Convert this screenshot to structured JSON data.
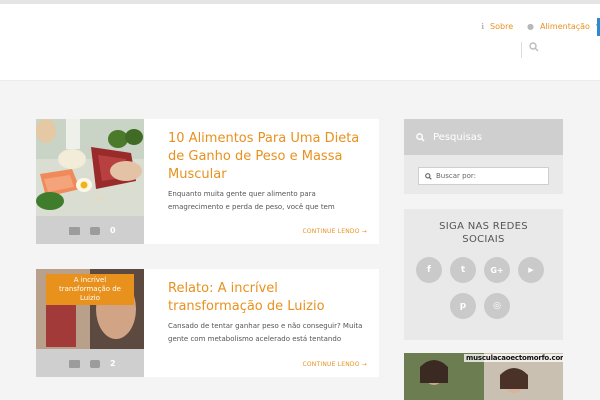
{
  "nav": {
    "items": [
      {
        "label": "Sobre",
        "icon": "info-icon"
      },
      {
        "label": "Alimentação",
        "icon": "apple-icon"
      }
    ],
    "search_icon": "search-icon"
  },
  "posts": [
    {
      "title": "10 Alimentos Para Uma Dieta de Ganho de Peso e Massa Muscular",
      "excerpt": "Enquanto muita gente quer alimento para emagrecimento e perda de peso, você que tem metabolismo acelerado quer justamente o",
      "read_more": "CONTINUE LENDO →",
      "comments": "0",
      "image": "foods-photo"
    },
    {
      "title": "Relato: A incrível transformação de Luizio",
      "image_caption": "A incrível transformação de Luizio",
      "excerpt": "Cansado de tentar ganhar peso e não conseguir? Muita gente com metabolismo acelerado está tentando transformar seu corpo seguindo",
      "read_more": "CONTINUE LENDO →",
      "comments": "2",
      "image": "transformation-photo"
    }
  ],
  "sidebar": {
    "search": {
      "title": "Pesquisas",
      "placeholder": "Buscar por:"
    },
    "social": {
      "title": "SIGA NAS REDES SOCIAIS",
      "buttons": [
        {
          "name": "facebook",
          "glyph": "f"
        },
        {
          "name": "twitter",
          "glyph": "t"
        },
        {
          "name": "google-plus",
          "glyph": "G+"
        },
        {
          "name": "youtube",
          "glyph": "▶"
        },
        {
          "name": "pinterest",
          "glyph": "p"
        },
        {
          "name": "instagram",
          "glyph": "◎"
        }
      ]
    },
    "banner": {
      "label": "musculacaoectomorfo.com"
    }
  },
  "colors": {
    "accent": "#e8911d",
    "widget_bg": "#e9e9e9",
    "header_bg": "#ffffff"
  }
}
